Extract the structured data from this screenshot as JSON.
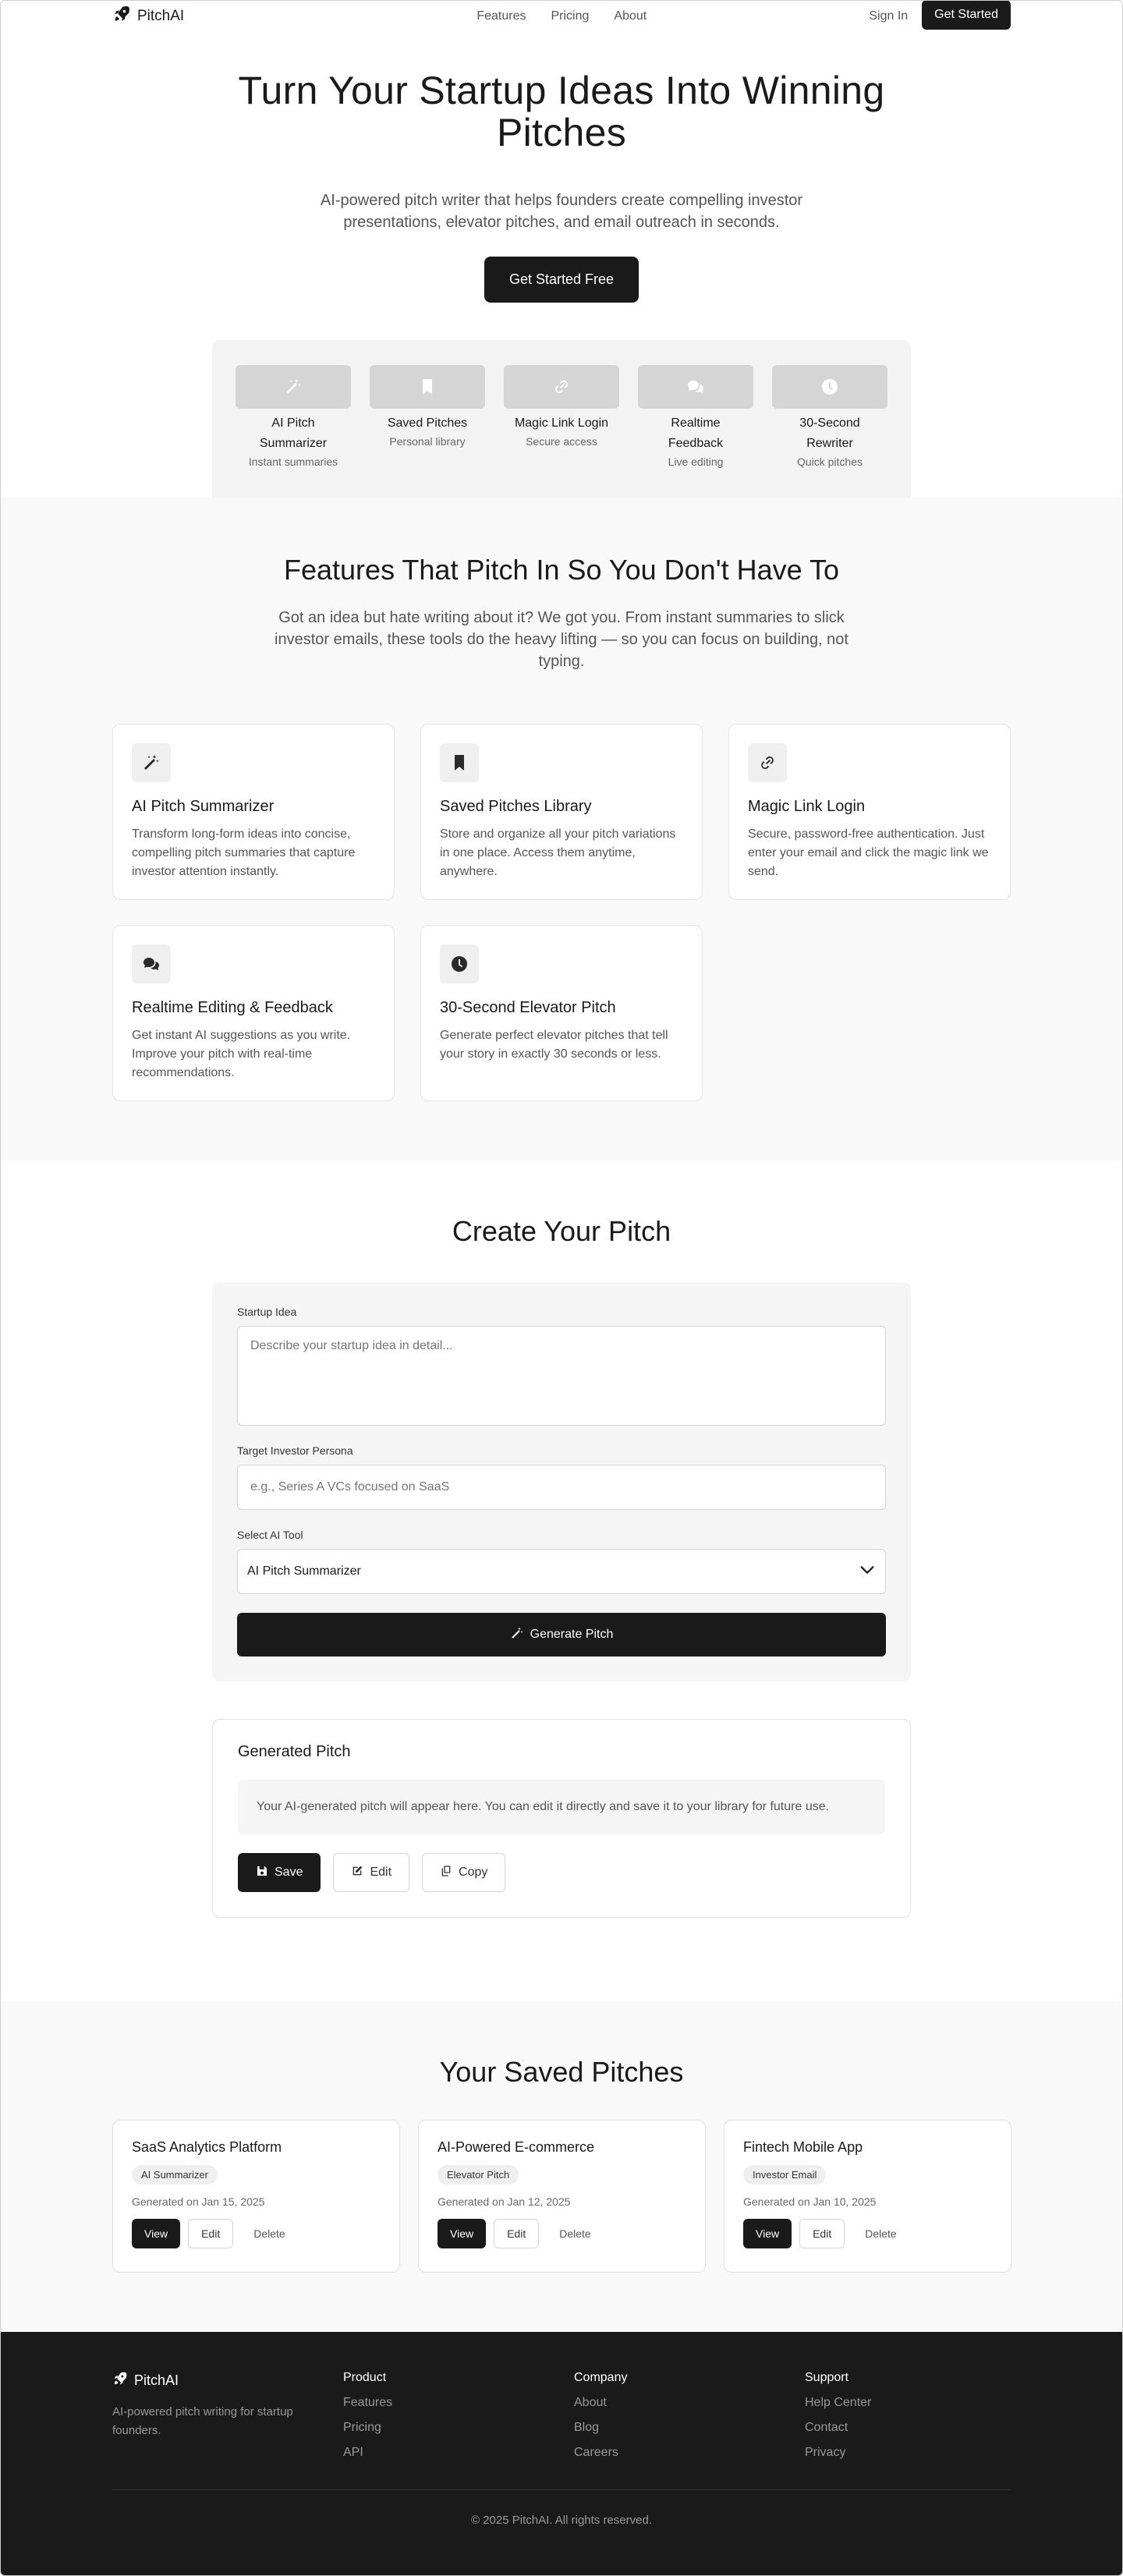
{
  "nav": {
    "brand": "PitchAI",
    "links": [
      "Features",
      "Pricing",
      "About"
    ],
    "signin": "Sign In",
    "cta": "Get Started"
  },
  "hero": {
    "title": "Turn Your Startup Ideas Into Winning Pitches",
    "subtitle": "AI-powered pitch writer that helps founders create compelling investor presentations, elevator pitches, and email outreach in seconds.",
    "cta": "Get Started Free",
    "tools": [
      {
        "icon": "magic-wand-icon",
        "name": "AI Pitch Summarizer",
        "sub": "Instant summaries"
      },
      {
        "icon": "bookmark-icon",
        "name": "Saved Pitches",
        "sub": "Personal library"
      },
      {
        "icon": "link-icon",
        "name": "Magic Link Login",
        "sub": "Secure access"
      },
      {
        "icon": "chat-icon",
        "name": "Realtime Feedback",
        "sub": "Live editing"
      },
      {
        "icon": "clock-icon",
        "name": "30-Second Rewriter",
        "sub": "Quick pitches"
      }
    ]
  },
  "features": {
    "title": "Features That Pitch In So You Don't Have To",
    "lead": "Got an idea but hate writing about it? We got you. From instant summaries to slick investor emails, these tools do the heavy lifting — so you can focus on building, not typing.",
    "cards": [
      {
        "icon": "magic-wand-icon",
        "title": "AI Pitch Summarizer",
        "desc": "Transform long-form ideas into concise, compelling pitch summaries that capture investor attention instantly."
      },
      {
        "icon": "bookmark-icon",
        "title": "Saved Pitches Library",
        "desc": "Store and organize all your pitch variations in one place. Access them anytime, anywhere."
      },
      {
        "icon": "link-icon",
        "title": "Magic Link Login",
        "desc": "Secure, password-free authentication. Just enter your email and click the magic link we send."
      },
      {
        "icon": "chat-icon",
        "title": "Realtime Editing & Feedback",
        "desc": "Get instant AI suggestions as you write. Improve your pitch with real-time recommendations."
      },
      {
        "icon": "clock-icon",
        "title": "30-Second Elevator Pitch",
        "desc": "Generate perfect elevator pitches that tell your story in exactly 30 seconds or less."
      }
    ]
  },
  "create": {
    "title": "Create Your Pitch",
    "idea_label": "Startup Idea",
    "idea_placeholder": "Describe your startup idea in detail...",
    "persona_label": "Target Investor Persona",
    "persona_placeholder": "e.g., Series A VCs focused on SaaS",
    "tool_label": "Select AI Tool",
    "tool_value": "AI Pitch Summarizer",
    "generate": "Generate Pitch",
    "result_title": "Generated Pitch",
    "result_text": "Your AI-generated pitch will appear here. You can edit it directly and save it to your library for future use.",
    "save": "Save",
    "edit": "Edit",
    "copy": "Copy"
  },
  "saved": {
    "title": "Your Saved Pitches",
    "items": [
      {
        "title": "SaaS Analytics Platform",
        "tag": "AI Summarizer",
        "date": "Generated on Jan 15, 2025"
      },
      {
        "title": "AI-Powered E-commerce",
        "tag": "Elevator Pitch",
        "date": "Generated on Jan 12, 2025"
      },
      {
        "title": "Fintech Mobile App",
        "tag": "Investor Email",
        "date": "Generated on Jan 10, 2025"
      }
    ],
    "view": "View",
    "edit": "Edit",
    "delete": "Delete"
  },
  "footer": {
    "brand": "PitchAI",
    "tagline": "AI-powered pitch writing for startup founders.",
    "columns": [
      {
        "head": "Product",
        "links": [
          "Features",
          "Pricing",
          "API"
        ]
      },
      {
        "head": "Company",
        "links": [
          "About",
          "Blog",
          "Careers"
        ]
      },
      {
        "head": "Support",
        "links": [
          "Help Center",
          "Contact",
          "Privacy"
        ]
      }
    ],
    "copyright": "© 2025 PitchAI. All rights reserved."
  },
  "colors": {
    "dark": "#1a1a1a",
    "muted": "#555555",
    "panel": "#f5f5f5",
    "section": "#f9f9f9"
  }
}
